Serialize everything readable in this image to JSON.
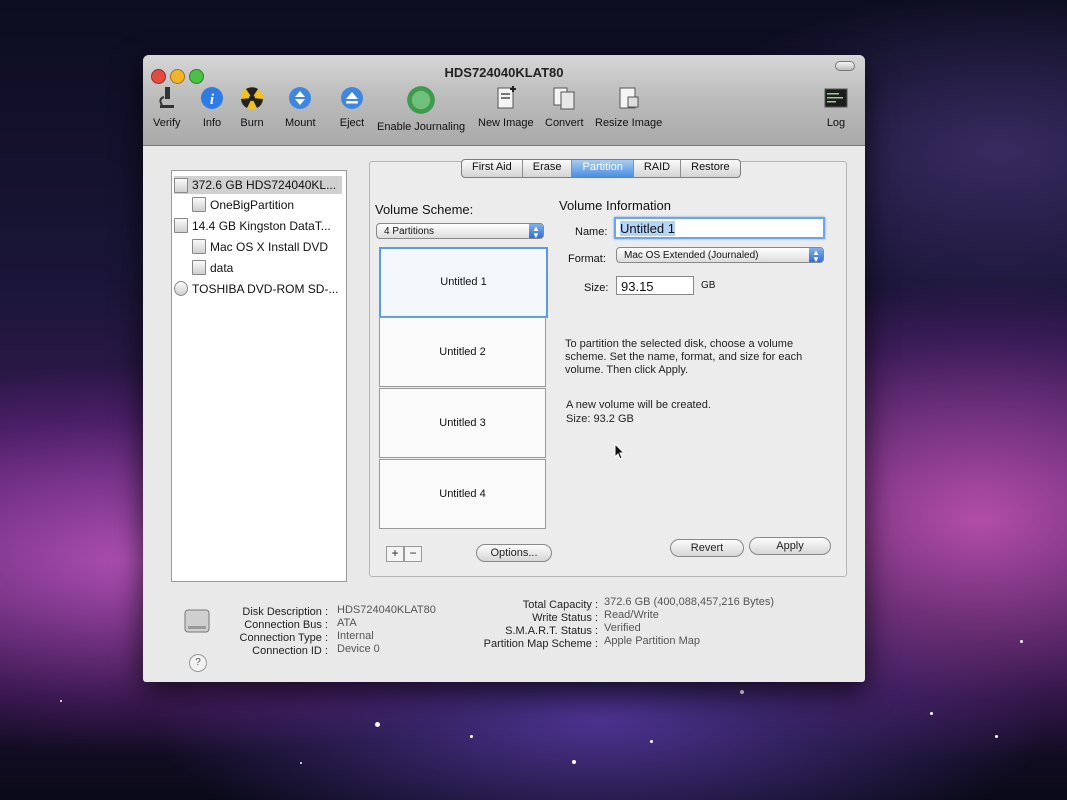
{
  "window": {
    "title": "HDS724040KLAT80"
  },
  "colors": {
    "close": "#e24b3f",
    "minimize": "#f0b429",
    "zoom": "#4cbf45",
    "accent": "#4b8ee1"
  },
  "toolbar": {
    "verify": "Verify",
    "info": "Info",
    "burn": "Burn",
    "mount": "Mount",
    "eject": "Eject",
    "journaling": "Enable Journaling",
    "new_image": "New Image",
    "convert": "Convert",
    "resize_image": "Resize Image",
    "log": "Log"
  },
  "sidebar": {
    "items": [
      {
        "label": "372.6 GB HDS724040KL...",
        "icon": "hard-drive-icon"
      },
      {
        "label": "OneBigPartition",
        "icon": "volume-icon"
      },
      {
        "label": "14.4 GB Kingston DataT...",
        "icon": "usb-drive-icon"
      },
      {
        "label": "Mac OS X Install DVD",
        "icon": "volume-icon"
      },
      {
        "label": "data",
        "icon": "volume-icon"
      },
      {
        "label": "TOSHIBA DVD-ROM SD-...",
        "icon": "optical-drive-icon"
      }
    ]
  },
  "tabs": [
    "First Aid",
    "Erase",
    "Partition",
    "RAID",
    "Restore"
  ],
  "volume_scheme": {
    "heading": "Volume Scheme:",
    "selected": "4 Partitions",
    "partitions": [
      "Untitled 1",
      "Untitled 2",
      "Untitled 3",
      "Untitled 4"
    ],
    "add": "+",
    "remove": "−",
    "options": "Options..."
  },
  "volume_info": {
    "heading": "Volume Information",
    "name_label": "Name:",
    "name_value": "Untitled 1",
    "format_label": "Format:",
    "format_value": "Mac OS Extended (Journaled)",
    "size_label": "Size:",
    "size_value": "93.15",
    "size_unit": "GB",
    "instructions": "To partition the selected disk, choose a volume scheme. Set the name, format, and size for each volume. Then click Apply.",
    "status_line1": "A new volume will be created.",
    "status_line2": "Size: 93.2 GB"
  },
  "buttons": {
    "revert": "Revert",
    "apply": "Apply",
    "help": "?"
  },
  "disk_info": {
    "left": [
      {
        "key": "Disk Description :",
        "value": "HDS724040KLAT80"
      },
      {
        "key": "Connection Bus :",
        "value": "ATA"
      },
      {
        "key": "Connection Type :",
        "value": "Internal"
      },
      {
        "key": "Connection ID :",
        "value": "Device 0"
      }
    ],
    "right": [
      {
        "key": "Total Capacity :",
        "value": "372.6 GB (400,088,457,216 Bytes)"
      },
      {
        "key": "Write Status :",
        "value": "Read/Write"
      },
      {
        "key": "S.M.A.R.T. Status :",
        "value": "Verified"
      },
      {
        "key": "Partition Map Scheme :",
        "value": "Apple Partition Map"
      }
    ]
  }
}
